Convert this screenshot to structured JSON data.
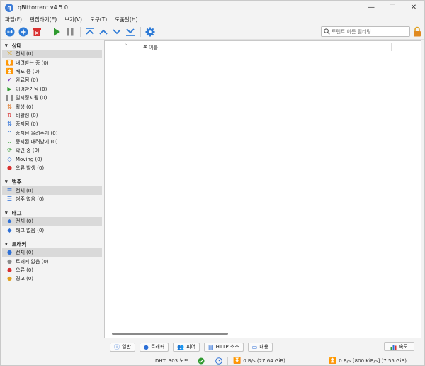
{
  "window": {
    "title": "qBittorrent v4.5.0",
    "controls": {
      "minimize": "—",
      "maximize": "☐",
      "close": "✕"
    }
  },
  "menu": [
    "파일(F)",
    "편집하기(E)",
    "보기(V)",
    "도구(T)",
    "도움말(H)"
  ],
  "toolbar": {
    "buttons": [
      "add-link-icon",
      "add-file-icon",
      "delete-icon",
      "resume-icon",
      "pause-icon",
      "move-top-icon",
      "move-up-icon",
      "move-down-icon",
      "move-bottom-icon",
      "settings-icon"
    ],
    "search_placeholder": "토렌트 이름 필터링"
  },
  "sidebar": {
    "status": {
      "header": "상태",
      "items": [
        {
          "label": "전체 (0)",
          "icon": "all-icon",
          "color": "#d9a520"
        },
        {
          "label": "내려받는 중 (0)",
          "icon": "download-icon",
          "color": "#2f9a2f"
        },
        {
          "label": "배포 중 (0)",
          "icon": "upload-icon",
          "color": "#2d6fd6"
        },
        {
          "label": "완료됨 (0)",
          "icon": "check-icon",
          "color": "#7b3fbf"
        },
        {
          "label": "이어받기됨 (0)",
          "icon": "play-icon",
          "color": "#2f9a2f"
        },
        {
          "label": "일시정지됨 (0)",
          "icon": "pause-icon",
          "color": "#8a8a8a"
        },
        {
          "label": "활성 (0)",
          "icon": "active-icon",
          "color": "#e0792a"
        },
        {
          "label": "비활성 (0)",
          "icon": "inactive-icon",
          "color": "#d83030"
        },
        {
          "label": "중지됨 (0)",
          "icon": "stalled-icon",
          "color": "#2d6fd6"
        },
        {
          "label": "중지된 올려주기 (0)",
          "icon": "stalled-upload-icon",
          "color": "#2d6fd6"
        },
        {
          "label": "중지된 내려받기 (0)",
          "icon": "stalled-download-icon",
          "color": "#2f9a2f"
        },
        {
          "label": "확인 중 (0)",
          "icon": "checking-icon",
          "color": "#2f9a2f"
        },
        {
          "label": "Moving (0)",
          "icon": "moving-icon",
          "color": "#2d6fd6"
        },
        {
          "label": "오류 발생 (0)",
          "icon": "error-icon",
          "color": "#d83030"
        }
      ]
    },
    "category": {
      "header": "범주",
      "items": [
        {
          "label": "전체 (0)",
          "icon": "list-icon"
        },
        {
          "label": "범주 없음 (0)",
          "icon": "list-icon"
        }
      ]
    },
    "tags": {
      "header": "태그",
      "items": [
        {
          "label": "전체 (0)",
          "icon": "tag-icon"
        },
        {
          "label": "태그 없음 (0)",
          "icon": "tag-icon"
        }
      ]
    },
    "trackers": {
      "header": "트래커",
      "items": [
        {
          "label": "전체 (0)",
          "icon": "tracker-icon",
          "color": "#2d6fd6"
        },
        {
          "label": "트래커 없음 (0)",
          "icon": "tracker-none-icon",
          "color": "#8a8a8a"
        },
        {
          "label": "오류 (0)",
          "icon": "tracker-error-icon",
          "color": "#d83030"
        },
        {
          "label": "경고 (0)",
          "icon": "tracker-warning-icon",
          "color": "#e0a020"
        }
      ]
    }
  },
  "main": {
    "columns": {
      "hash": "#",
      "name": "이름"
    }
  },
  "tabs": [
    {
      "label": "일반",
      "icon": "info-icon"
    },
    {
      "label": "트래커",
      "icon": "tracker-icon"
    },
    {
      "label": "피어",
      "icon": "peers-icon"
    },
    {
      "label": "HTTP 소스",
      "icon": "server-icon"
    },
    {
      "label": "내용",
      "icon": "folder-icon"
    }
  ],
  "speed_button": "속도",
  "status_bar": {
    "dht": "DHT: 303 노드",
    "download": "0 B/s (27.64 GiB)",
    "upload": "0 B/s [800 KiB/s] (7.55 GiB)"
  }
}
